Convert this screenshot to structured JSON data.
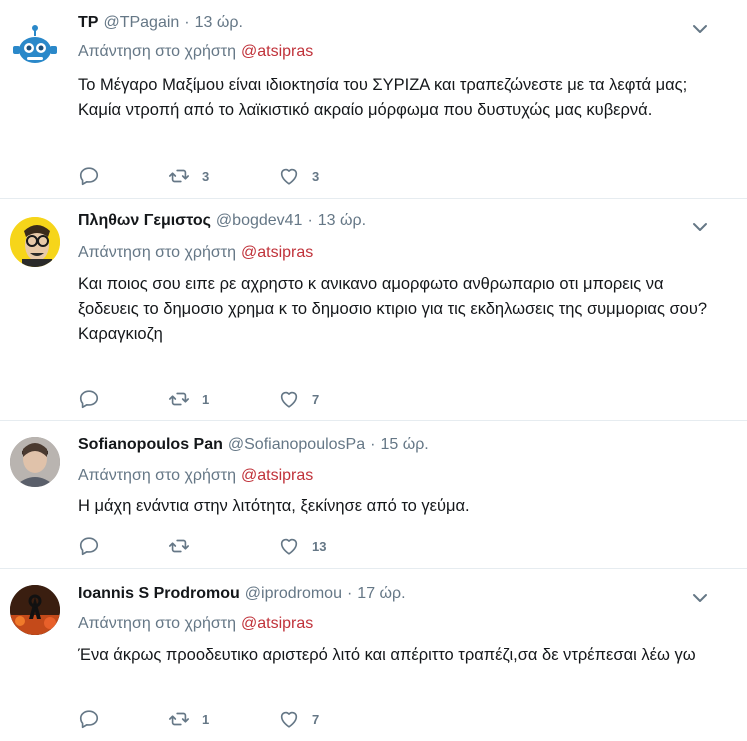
{
  "reply_prefix": "Απάντηση στο χρήστη",
  "tweets": [
    {
      "fullname": "TP",
      "username": "@TPagain",
      "separator": "·",
      "time": "13 ώρ.",
      "mention": "@atsipras",
      "text": [
        "Το Μέγαρο Μαξίμου είναι ιδιοκτησία του ΣΥΡΙΖΑ και τραπεζώνεστε με τα λεφτά μας; Καμία ντροπή από το λαϊκιστικό ακραίο μόρφωμα που δυστυχώς μας κυβερνά."
      ],
      "replies": "",
      "retweets": "3",
      "likes": "3"
    },
    {
      "fullname": "Πληθων Γεμιστος",
      "username": "@bogdev41",
      "separator": "·",
      "time": "13 ώρ.",
      "mention": "@atsipras",
      "text": [
        "Και ποιος σου ειπε ρε αχρηστο κ ανικανο αμορφωτο ανθρωπαριο οτι μπορεις να ξοδευεις το δημοσιο χρημα κ το δημοσιο κτιριο για τις εκδηλωσεις της συμμοριας σου?",
        "Καραγκιοζη"
      ],
      "replies": "",
      "retweets": "1",
      "likes": "7"
    },
    {
      "fullname": "Sofianopoulos Pan",
      "username": "@SofianopoulosPa",
      "separator": "·",
      "time": "15 ώρ.",
      "mention": "@atsipras",
      "text": [
        "Η μάχη ενάντια στην λιτότητα, ξεκίνησε από το γεύμα."
      ],
      "replies": "",
      "retweets": "",
      "likes": "13"
    },
    {
      "fullname": "Ioannis S Prodromou",
      "username": "@iprodromou",
      "separator": "·",
      "time": "17 ώρ.",
      "mention": "@atsipras",
      "text": [
        "Ένα άκρως προοδευτικο αριστερό λιτό και απέριττο τραπέζι,σα δε ντρέπεσαι λέω γω"
      ],
      "replies": "",
      "retweets": "1",
      "likes": "7"
    }
  ],
  "icons": {
    "reply": "reply-icon",
    "retweet": "retweet-icon",
    "like": "heart-icon",
    "more": "chevron-down-icon"
  },
  "colors": {
    "mention": "#c0323a",
    "secondary_text": "#657786",
    "divider": "#e6ecf0"
  }
}
